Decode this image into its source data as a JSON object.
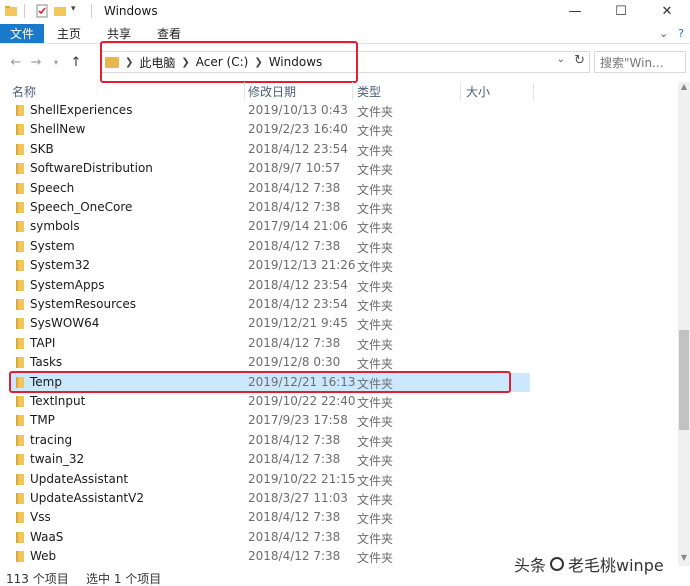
{
  "window": {
    "title": "Windows",
    "controls": {
      "minimize": "—",
      "maximize": "☐",
      "close": "✕"
    }
  },
  "ribbon": {
    "file_tab": "文件",
    "tabs": [
      "主页",
      "共享",
      "查看"
    ]
  },
  "address": {
    "crumbs": [
      "此电脑",
      "Acer (C:)",
      "Windows"
    ],
    "search_placeholder": "搜索\"Win..."
  },
  "columns": {
    "name": "名称",
    "date": "修改日期",
    "type": "类型",
    "size": "大小"
  },
  "files": [
    {
      "name": "ShellExperiences",
      "date": "2019/10/13 0:43",
      "type": "文件夹"
    },
    {
      "name": "ShellNew",
      "date": "2019/2/23 16:40",
      "type": "文件夹"
    },
    {
      "name": "SKB",
      "date": "2018/4/12 23:54",
      "type": "文件夹"
    },
    {
      "name": "SoftwareDistribution",
      "date": "2018/9/7 10:57",
      "type": "文件夹"
    },
    {
      "name": "Speech",
      "date": "2018/4/12 7:38",
      "type": "文件夹"
    },
    {
      "name": "Speech_OneCore",
      "date": "2018/4/12 7:38",
      "type": "文件夹"
    },
    {
      "name": "symbols",
      "date": "2017/9/14 21:06",
      "type": "文件夹"
    },
    {
      "name": "System",
      "date": "2018/4/12 7:38",
      "type": "文件夹"
    },
    {
      "name": "System32",
      "date": "2019/12/13 21:26",
      "type": "文件夹"
    },
    {
      "name": "SystemApps",
      "date": "2018/4/12 23:54",
      "type": "文件夹"
    },
    {
      "name": "SystemResources",
      "date": "2018/4/12 23:54",
      "type": "文件夹"
    },
    {
      "name": "SysWOW64",
      "date": "2019/12/21 9:45",
      "type": "文件夹"
    },
    {
      "name": "TAPI",
      "date": "2018/4/12 7:38",
      "type": "文件夹"
    },
    {
      "name": "Tasks",
      "date": "2019/12/8 0:30",
      "type": "文件夹"
    },
    {
      "name": "Temp",
      "date": "2019/12/21 16:13",
      "type": "文件夹"
    },
    {
      "name": "TextInput",
      "date": "2019/10/22 22:40",
      "type": "文件夹"
    },
    {
      "name": "TMP",
      "date": "2017/9/23 17:58",
      "type": "文件夹"
    },
    {
      "name": "tracing",
      "date": "2018/4/12 7:38",
      "type": "文件夹"
    },
    {
      "name": "twain_32",
      "date": "2018/4/12 7:38",
      "type": "文件夹"
    },
    {
      "name": "UpdateAssistant",
      "date": "2019/10/22 21:15",
      "type": "文件夹"
    },
    {
      "name": "UpdateAssistantV2",
      "date": "2018/3/27 11:03",
      "type": "文件夹"
    },
    {
      "name": "Vss",
      "date": "2018/4/12 7:38",
      "type": "文件夹"
    },
    {
      "name": "WaaS",
      "date": "2018/4/12 7:38",
      "type": "文件夹"
    },
    {
      "name": "Web",
      "date": "2018/4/12 7:38",
      "type": "文件夹"
    }
  ],
  "selected_index": 14,
  "status": {
    "count": "113 个项目",
    "selected": "选中 1 个项目"
  },
  "watermark": {
    "left": "头条",
    "right": "老毛桃winpe"
  },
  "colors": {
    "accent": "#1979ca",
    "selection": "#cce8ff",
    "highlight": "#e0202f"
  }
}
